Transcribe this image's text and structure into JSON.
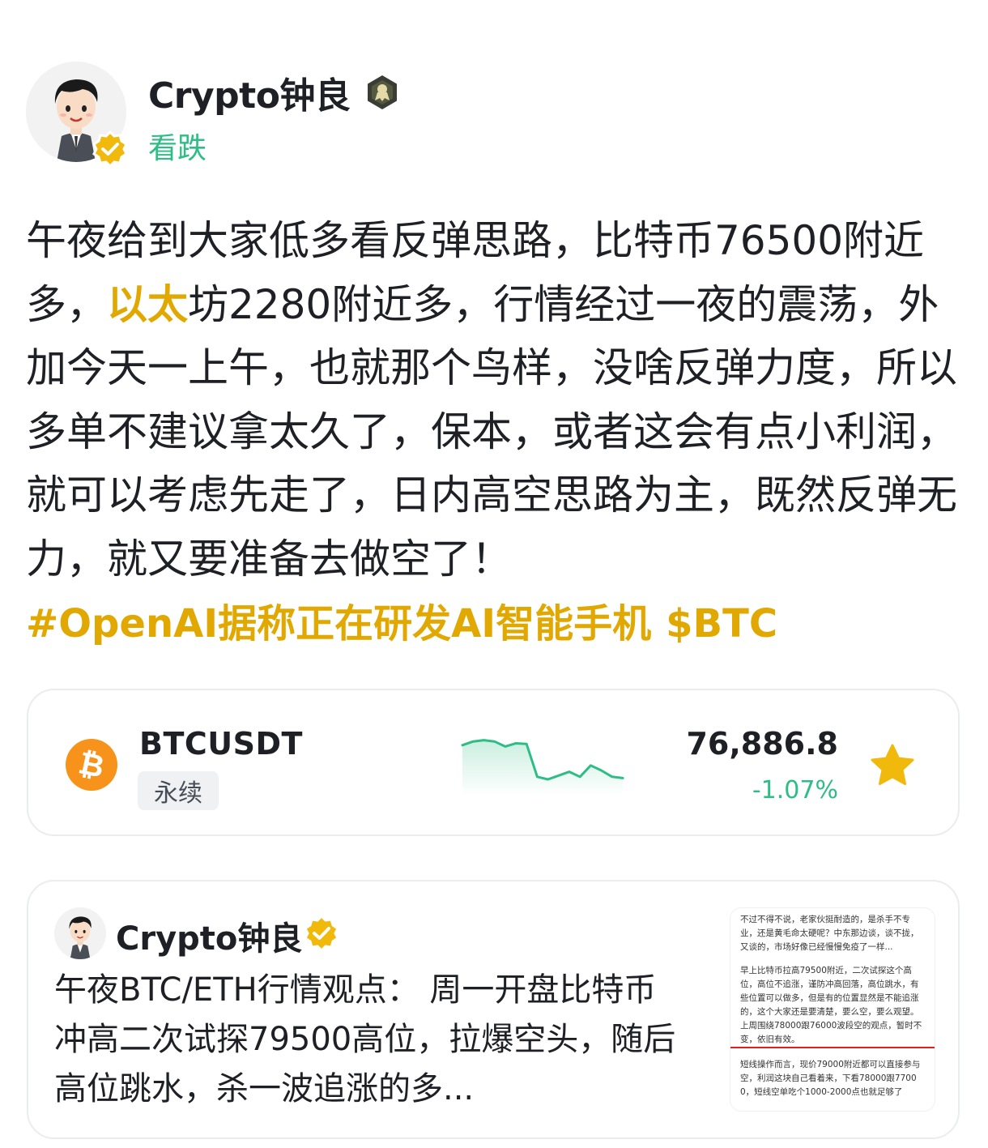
{
  "author": {
    "name": "Crypto钟良",
    "stance": "看跌",
    "avatar_icon": "cartoon-avatar",
    "verified_icon": "verified-check-icon",
    "level_icon": "level-badge-icon"
  },
  "post": {
    "text_before": "午夜给到大家低多看反弹思路，比特币76500附近多，",
    "highlight": "以太",
    "text_after": "坊2280附近多，行情经过一夜的震荡，外加今天一上午，也就那个鸟样，没啥反弹力度，所以多单不建议拿太久了，保本，或者这会有点小利润，就可以考虑先走了，日内高空思路为主，既然反弹无力，就又要准备去做空了！",
    "hashtag": "#OpenAI据称正在研发AI智能手机",
    "cashtag": "$BTC",
    "highlight_color": "#e0a800"
  },
  "ticker": {
    "symbol": "BTCUSDT",
    "contract_type": "永续",
    "price": "76,886.8",
    "change": "-1.07%",
    "icon": "bitcoin-icon",
    "favorite_icon": "star-icon",
    "change_color": "#2ebd85",
    "sparkline": [
      0.72,
      0.78,
      0.8,
      0.78,
      0.7,
      0.75,
      0.74,
      0.22,
      0.18,
      0.24,
      0.3,
      0.22,
      0.4,
      0.32,
      0.22,
      0.2
    ]
  },
  "quoted_post": {
    "author_name": "Crypto钟良",
    "text": "午夜BTC/ETH行情观点： 周一开盘比特币冲高二次试探79500高位，拉爆空头，随后高位跳水，杀一波追涨的多...",
    "image_para_1": "不过不得不说，老家伙挺耐造的，是杀手不专业，还是黄毛命太硬呢？中东那边谈，谈不拢，又谈的，市场好像已经慢慢免疫了一样...",
    "image_para_2": "早上比特币拉高79500附近，二次试探这个高位，高位不追涨，谨防冲高回落，高位跳水，有些位置可以做多，但是有的位置显然是不能追涨的，这个大家还是要清楚，要么空，要么观望。上周围绕78000跟76000波段空的观点，暂时不变，依旧有效。",
    "image_para_3": "短线操作而言，现价79000附近都可以直接参与空，利润这块自己看着来，下看78000跟77000，短线空单吃个1000-2000点也就足够了"
  }
}
